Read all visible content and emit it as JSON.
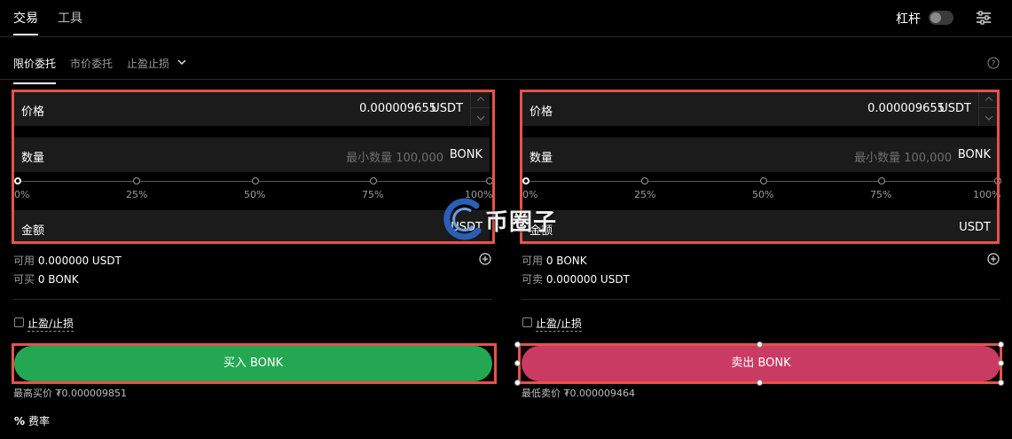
{
  "top_tabs": [
    "交易",
    "工具"
  ],
  "leverage_label": "杠杆",
  "order_tabs": [
    "限价委托",
    "市价委托",
    "止盈止损"
  ],
  "slider_marks": [
    "0%",
    "25%",
    "50%",
    "75%",
    "100%"
  ],
  "buy": {
    "price_label": "价格",
    "price_value": "0.000009655",
    "price_unit": "USDT",
    "qty_label": "数量",
    "qty_placeholder": "最小数量 100,000",
    "qty_unit": "BONK",
    "amount_label": "金额",
    "amount_unit": "USDT",
    "avail_label": "可用",
    "avail_value": "0.000000 USDT",
    "can_label": "可买",
    "can_value": "0 BONK",
    "tpsl_label": "止盈/止损",
    "button_label": "买入 BONK",
    "note": "最高买价 ₮0.000009851"
  },
  "sell": {
    "price_label": "价格",
    "price_value": "0.000009655",
    "price_unit": "USDT",
    "qty_label": "数量",
    "qty_placeholder": "最小数量 100,000",
    "qty_unit": "BONK",
    "amount_label": "金额",
    "amount_unit": "USDT",
    "avail_label": "可用",
    "avail_value": "0 BONK",
    "can_label": "可卖",
    "can_value": "0.000000 USDT",
    "tpsl_label": "止盈/止损",
    "button_label": "卖出 BONK",
    "note": "最低卖价 ₮0.000009464"
  },
  "fee_label": "费率",
  "watermark_text": "币圈子",
  "colors": {
    "buy": "#23a752",
    "sell": "#c93b63",
    "highlight": "#e5534b"
  }
}
